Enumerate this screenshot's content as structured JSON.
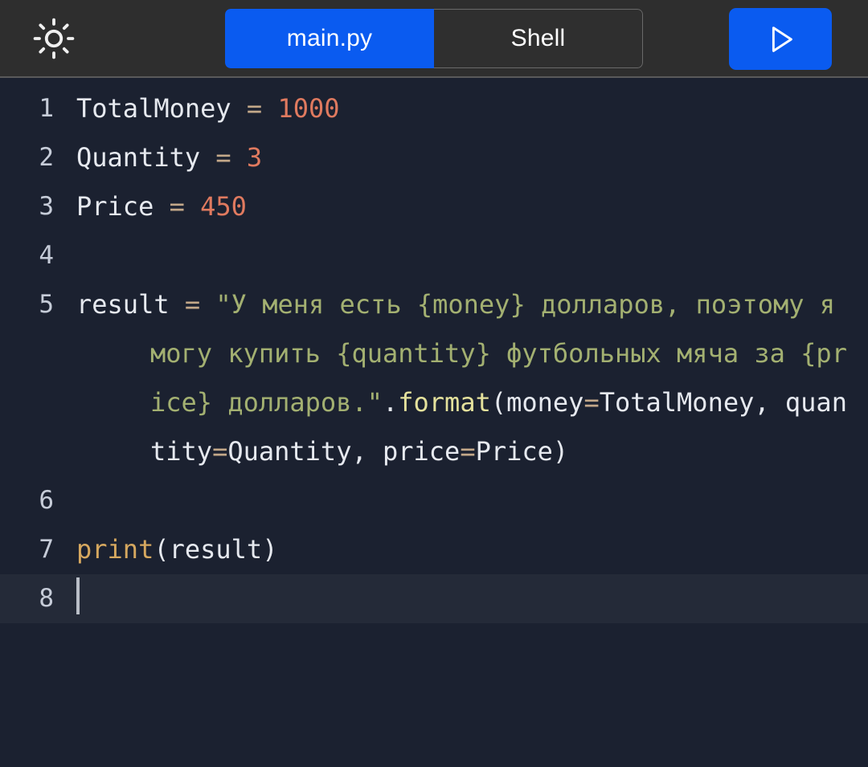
{
  "toolbar": {
    "theme_toggle_icon": "sun-icon",
    "tabs": [
      {
        "label": "main.py",
        "active": true
      },
      {
        "label": "Shell",
        "active": false
      }
    ],
    "run_button_icon": "play-icon",
    "accent_color": "#0a5bf0",
    "background_color": "#2e2e2e"
  },
  "editor": {
    "filename": "main.py",
    "background_color": "#1b2130",
    "active_line_color": "#242a38",
    "line_numbers": [
      "1",
      "2",
      "3",
      "4",
      "5",
      "6",
      "7",
      "8"
    ],
    "colors": {
      "plain": "#e6e9ef",
      "operator": "#c3a889",
      "number": "#e07a5f",
      "string": "#a3b071",
      "function": "#e4e19c",
      "keyword": "#d6a85f",
      "line_number": "#c6ccd8",
      "cursor": "#b9bec7"
    },
    "lines": [
      {
        "number": "1",
        "tokens": [
          {
            "text": "TotalMoney ",
            "type": "plain"
          },
          {
            "text": "=",
            "type": "operator"
          },
          {
            "text": " ",
            "type": "plain"
          },
          {
            "text": "1000",
            "type": "number"
          }
        ]
      },
      {
        "number": "2",
        "tokens": [
          {
            "text": "Quantity ",
            "type": "plain"
          },
          {
            "text": "=",
            "type": "operator"
          },
          {
            "text": " ",
            "type": "plain"
          },
          {
            "text": "3",
            "type": "number"
          }
        ]
      },
      {
        "number": "3",
        "tokens": [
          {
            "text": "Price ",
            "type": "plain"
          },
          {
            "text": "=",
            "type": "operator"
          },
          {
            "text": " ",
            "type": "plain"
          },
          {
            "text": "450",
            "type": "number"
          }
        ]
      },
      {
        "number": "4",
        "tokens": []
      },
      {
        "number": "5",
        "wrapped": true,
        "tokens": [
          {
            "text": "result ",
            "type": "plain"
          },
          {
            "text": "=",
            "type": "operator"
          },
          {
            "text": " ",
            "type": "plain"
          },
          {
            "text": "\"У меня есть {money} долларов, поэтому я могу купить {quantity} футбольных мяча за {price} долларов.\"",
            "type": "string"
          },
          {
            "text": ".",
            "type": "plain"
          },
          {
            "text": "format",
            "type": "function"
          },
          {
            "text": "(money",
            "type": "plain"
          },
          {
            "text": "=",
            "type": "operator"
          },
          {
            "text": "TotalMoney, quantity",
            "type": "plain"
          },
          {
            "text": "=",
            "type": "operator"
          },
          {
            "text": "Quantity, price",
            "type": "plain"
          },
          {
            "text": "=",
            "type": "operator"
          },
          {
            "text": "Price)",
            "type": "plain"
          }
        ]
      },
      {
        "number": "6",
        "tokens": []
      },
      {
        "number": "7",
        "tokens": [
          {
            "text": "print",
            "type": "keyword"
          },
          {
            "text": "(result)",
            "type": "plain"
          }
        ]
      },
      {
        "number": "8",
        "active": true,
        "cursor": true,
        "tokens": []
      }
    ]
  }
}
